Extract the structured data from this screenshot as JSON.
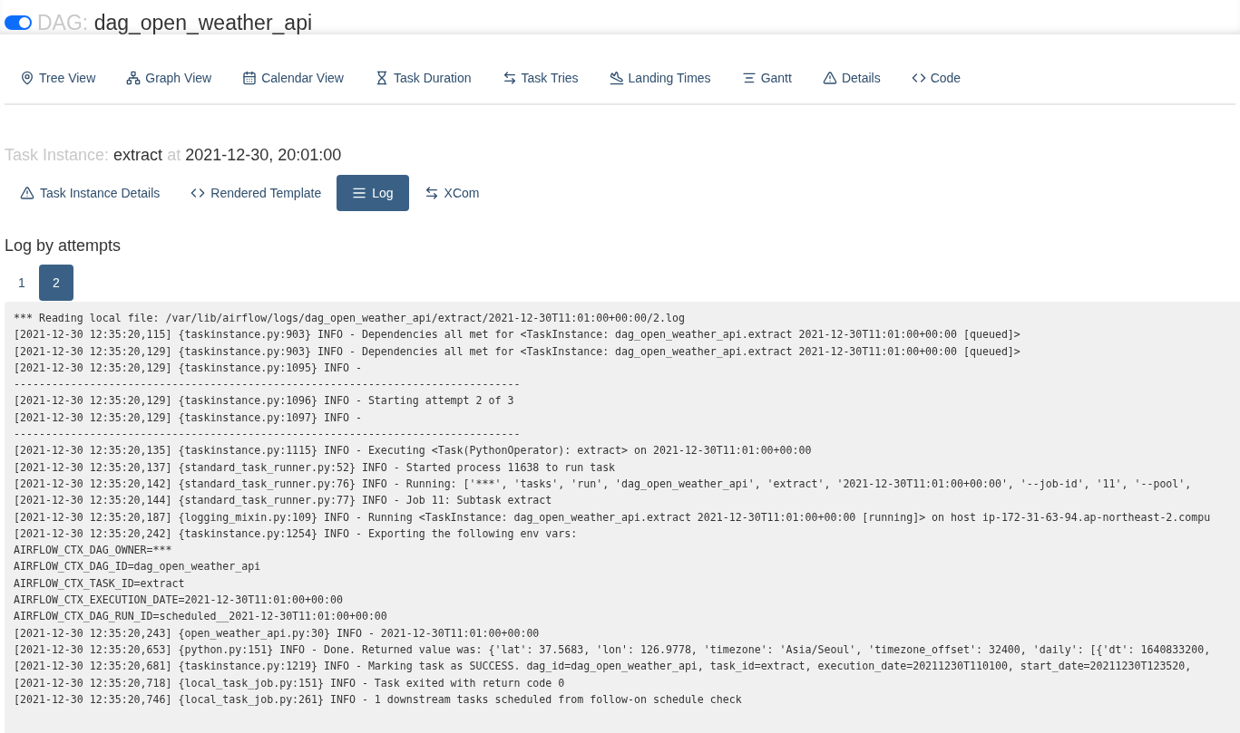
{
  "dag": {
    "toggle_on": true,
    "prefix": "DAG:",
    "name": "dag_open_weather_api"
  },
  "views": [
    {
      "kind": "tree",
      "label": "Tree View"
    },
    {
      "kind": "graph",
      "label": "Graph View"
    },
    {
      "kind": "calendar",
      "label": "Calendar View"
    },
    {
      "kind": "duration",
      "label": "Task Duration"
    },
    {
      "kind": "tries",
      "label": "Task Tries"
    },
    {
      "kind": "landing",
      "label": "Landing Times"
    },
    {
      "kind": "gantt",
      "label": "Gantt"
    },
    {
      "kind": "details",
      "label": "Details"
    },
    {
      "kind": "code",
      "label": "Code"
    }
  ],
  "task_instance": {
    "prefix": "Task Instance:",
    "task": "extract",
    "at": "at",
    "date": "2021-12-30, 20:01:00"
  },
  "tabs": [
    {
      "kind": "details",
      "label": "Task Instance Details",
      "selected": false
    },
    {
      "kind": "code",
      "label": "Rendered Template",
      "selected": false
    },
    {
      "kind": "log",
      "label": "Log",
      "selected": true
    },
    {
      "kind": "tries",
      "label": "XCom",
      "selected": false
    }
  ],
  "log_heading": "Log by attempts",
  "attempts": [
    {
      "label": "1",
      "selected": false
    },
    {
      "label": "2",
      "selected": true
    }
  ],
  "log_lines": [
    "*** Reading local file: /var/lib/airflow/logs/dag_open_weather_api/extract/2021-12-30T11:01:00+00:00/2.log",
    "[2021-12-30 12:35:20,115] {taskinstance.py:903} INFO - Dependencies all met for <TaskInstance: dag_open_weather_api.extract 2021-12-30T11:01:00+00:00 [queued]>",
    "[2021-12-30 12:35:20,129] {taskinstance.py:903} INFO - Dependencies all met for <TaskInstance: dag_open_weather_api.extract 2021-12-30T11:01:00+00:00 [queued]>",
    "[2021-12-30 12:35:20,129] {taskinstance.py:1095} INFO -",
    "--------------------------------------------------------------------------------",
    "[2021-12-30 12:35:20,129] {taskinstance.py:1096} INFO - Starting attempt 2 of 3",
    "[2021-12-30 12:35:20,129] {taskinstance.py:1097} INFO -",
    "--------------------------------------------------------------------------------",
    "[2021-12-30 12:35:20,135] {taskinstance.py:1115} INFO - Executing <Task(PythonOperator): extract> on 2021-12-30T11:01:00+00:00",
    "[2021-12-30 12:35:20,137] {standard_task_runner.py:52} INFO - Started process 11638 to run task",
    "[2021-12-30 12:35:20,142] {standard_task_runner.py:76} INFO - Running: ['***', 'tasks', 'run', 'dag_open_weather_api', 'extract', '2021-12-30T11:01:00+00:00', '--job-id', '11', '--pool',",
    "[2021-12-30 12:35:20,144] {standard_task_runner.py:77} INFO - Job 11: Subtask extract",
    "[2021-12-30 12:35:20,187] {logging_mixin.py:109} INFO - Running <TaskInstance: dag_open_weather_api.extract 2021-12-30T11:01:00+00:00 [running]> on host ip-172-31-63-94.ap-northeast-2.compu",
    "[2021-12-30 12:35:20,242] {taskinstance.py:1254} INFO - Exporting the following env vars:",
    "AIRFLOW_CTX_DAG_OWNER=***",
    "AIRFLOW_CTX_DAG_ID=dag_open_weather_api",
    "AIRFLOW_CTX_TASK_ID=extract",
    "AIRFLOW_CTX_EXECUTION_DATE=2021-12-30T11:01:00+00:00",
    "AIRFLOW_CTX_DAG_RUN_ID=scheduled__2021-12-30T11:01:00+00:00",
    "[2021-12-30 12:35:20,243] {open_weather_api.py:30} INFO - 2021-12-30T11:01:00+00:00",
    "[2021-12-30 12:35:20,653] {python.py:151} INFO - Done. Returned value was: {'lat': 37.5683, 'lon': 126.9778, 'timezone': 'Asia/Seoul', 'timezone_offset': 32400, 'daily': [{'dt': 1640833200,",
    "[2021-12-30 12:35:20,681] {taskinstance.py:1219} INFO - Marking task as SUCCESS. dag_id=dag_open_weather_api, task_id=extract, execution_date=20211230T110100, start_date=20211230T123520,",
    "[2021-12-30 12:35:20,718] {local_task_job.py:151} INFO - Task exited with return code 0",
    "[2021-12-30 12:35:20,746] {local_task_job.py:261} INFO - 1 downstream tasks scheduled from follow-on schedule check"
  ]
}
